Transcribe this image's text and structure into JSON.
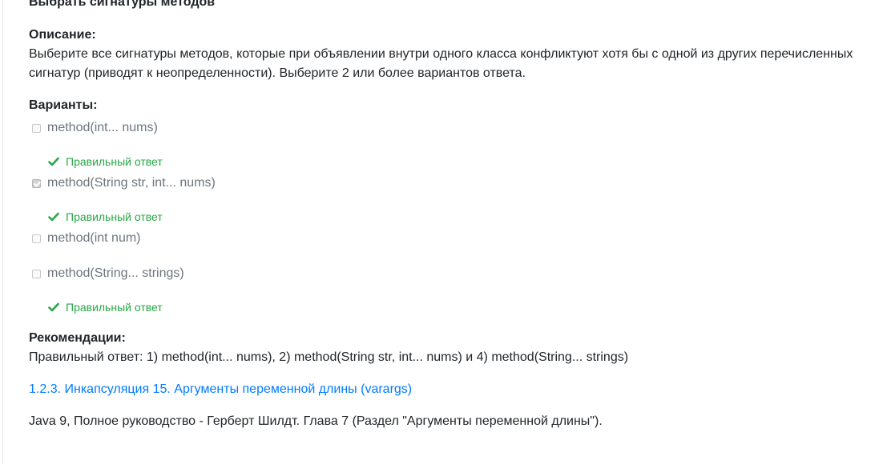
{
  "title": "Выбрать сигнатуры методов",
  "description": {
    "heading": "Описание:",
    "text": "Выберите все сигнатуры методов, которые при объявлении внутри одного класса конфликтуют хотя бы с одной из других перечисленных сигнатур (приводят к неопределенности). Выберите 2 или более вариантов ответа."
  },
  "options": {
    "heading": "Варианты:",
    "items": [
      {
        "label": "method(int... nums)",
        "checked": false,
        "correct": true
      },
      {
        "label": "method(String str, int... nums)",
        "checked": true,
        "correct": true
      },
      {
        "label": "method(int num)",
        "checked": false,
        "correct": false
      },
      {
        "label": "method(String... strings)",
        "checked": false,
        "correct": true
      }
    ],
    "correct_label": "Правильный ответ"
  },
  "recommendations": {
    "heading": "Рекомендации:",
    "text": "Правильный ответ: 1) method(int... nums), 2) method(String str, int... nums) и 4) method(String... strings)",
    "link_text": "1.2.3. Инкапсуляция 15. Аргументы переменной длины (varargs)",
    "reference": "Java 9, Полное руководство - Герберт Шилдт. Глава 7 (Раздел \"Аргументы переменной длины\")."
  },
  "colors": {
    "correct": "#28a745",
    "link": "#007bff",
    "muted": "#6c757d"
  }
}
